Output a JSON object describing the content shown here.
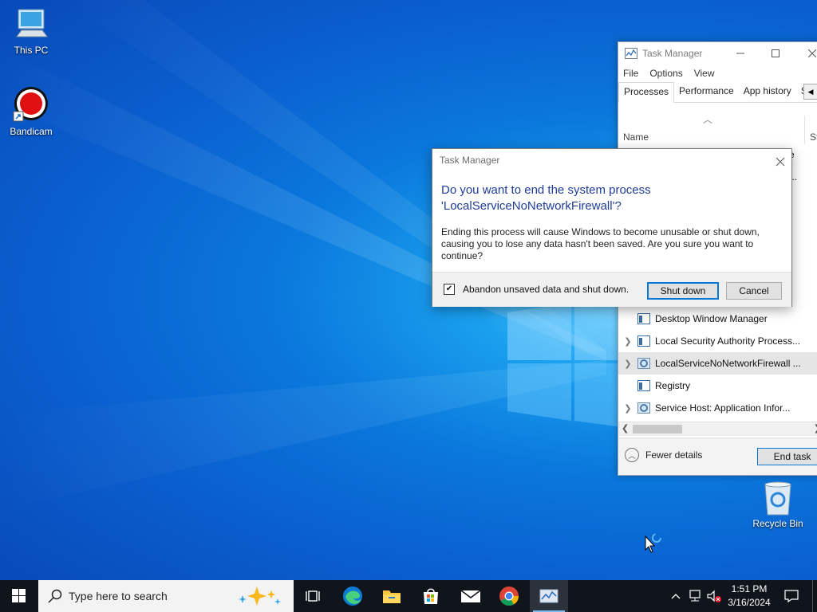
{
  "desktop": {
    "icons": [
      {
        "label": "This PC"
      },
      {
        "label": "Bandicam"
      },
      {
        "label": "Recycle Bin"
      }
    ]
  },
  "task_manager": {
    "title": "Task Manager",
    "menu": [
      "File",
      "Options",
      "View"
    ],
    "tabs": [
      "Processes",
      "Performance",
      "App history",
      "S"
    ],
    "columns": {
      "name": "Name",
      "status": "St"
    },
    "partial_rows": [
      "e",
      "..."
    ],
    "processes": [
      {
        "name": "Desktop Window Manager",
        "expandable": false,
        "icon": "app-window-icon"
      },
      {
        "name": "Local Security Authority Process...",
        "expandable": true,
        "icon": "app-window-icon"
      },
      {
        "name": "LocalServiceNoNetworkFirewall ...",
        "expandable": true,
        "icon": "gear-icon",
        "selected": true
      },
      {
        "name": "Registry",
        "expandable": false,
        "icon": "app-window-icon"
      },
      {
        "name": "Service Host: Application Infor...",
        "expandable": true,
        "icon": "gear-icon"
      }
    ],
    "fewer_details": "Fewer details",
    "end_task": "End task"
  },
  "dialog": {
    "title": "Task Manager",
    "heading_line1": "Do you want to end the system process",
    "heading_line2": "'LocalServiceNoNetworkFirewall'?",
    "body": "Ending this process will cause Windows to become unusable or shut down, causing you to lose any data hasn't been saved. Are you sure you want to continue?",
    "checkbox_label": "Abandon unsaved data and shut down.",
    "checkbox_checked": true,
    "shutdown_button": "Shut down",
    "cancel_button": "Cancel"
  },
  "taskbar": {
    "search_placeholder": "Type here to search",
    "time": "1:51 PM",
    "date": "3/16/2024",
    "pinned": [
      "task-view-icon",
      "edge-icon",
      "file-explorer-icon",
      "store-icon",
      "mail-icon",
      "chrome-icon",
      "task-manager-icon"
    ]
  },
  "colors": {
    "accent": "#0078d7",
    "dialog_heading": "#1f3d99",
    "taskbar": "#10151c"
  }
}
